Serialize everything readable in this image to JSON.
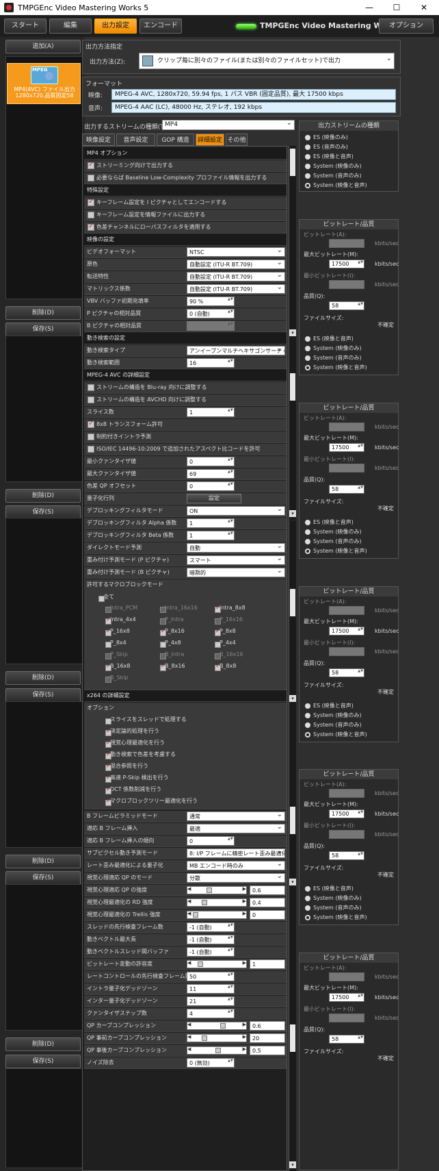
{
  "window": {
    "title": "TMPGEnc Video Mastering Works 5",
    "min": "—",
    "max": "☐",
    "close": "✕"
  },
  "nav": {
    "start": "スタート",
    "edit": "編集",
    "output": "出力設定",
    "encode": "エンコード",
    "brand": "TMPGEnc Video Mastering Works 5",
    "options": "オプション"
  },
  "left": {
    "add": "追加(A)",
    "delete": "削除(D)",
    "save": "保存(S)",
    "clip": {
      "badge": "MPEG",
      "line1": "MP4(AVC) ファイル出力",
      "line2": "1280x720,品質固定58"
    }
  },
  "output_method": {
    "header": "出力方法指定",
    "label": "出力方法(Z):",
    "value": "クリップ毎に別々のファイル(または別々のファイルセット)で出力"
  },
  "format": {
    "header": "フォーマット",
    "video_label": "映像:",
    "video": "MPEG-4 AVC, 1280x720, 59.94 fps, 1 パス VBR (固定品質), 最大 17500 kbps",
    "audio_label": "音声:",
    "audio": "MPEG-4 AAC (LC), 48000 Hz, ステレオ, 192 kbps"
  },
  "stream": {
    "label": "出力するストリームの種類(T):",
    "value": "MP4"
  },
  "tabs": [
    "映像設定",
    "音声設定",
    "GOP 構造",
    "詳細設定",
    "その他"
  ],
  "rows": [
    {
      "k": "h",
      "t": "MP4 オプション"
    },
    {
      "k": "c",
      "t": "ストリーミング向けで出力する",
      "on": true
    },
    {
      "k": "c",
      "t": "必要ならば Baseline Low-Complexity プロファイル情報を出力する",
      "on": false
    },
    {
      "k": "h",
      "t": "特殊設定"
    },
    {
      "k": "c",
      "t": "キーフレーム設定を I ピクチャとしてエンコードする",
      "on": true
    },
    {
      "k": "c",
      "t": "キーフレーム設定を情報ファイルに出力する",
      "on": false
    },
    {
      "k": "c",
      "t": "色差チャンネルにローパスフィルタを適用する",
      "on": true
    },
    {
      "k": "h",
      "t": "映像の設定"
    },
    {
      "k": "d",
      "t": "ビデオフォーマット",
      "v": "NTSC"
    },
    {
      "k": "d",
      "t": "原色",
      "v": "自動設定 (ITU-R BT.709)"
    },
    {
      "k": "d",
      "t": "転送特性",
      "v": "自動設定 (ITU-R BT.709)"
    },
    {
      "k": "d",
      "t": "マトリックス係数",
      "v": "自動設定 (ITU-R BT.709)"
    },
    {
      "k": "s",
      "t": "VBV バッファ初期充填率",
      "v": "90 %"
    },
    {
      "k": "s",
      "t": "P ピクチャの相対品質",
      "v": "0 (自動)"
    },
    {
      "k": "x",
      "t": "B ピクチャの相対品質",
      "v": ""
    },
    {
      "k": "h",
      "t": "動き検索の設定"
    },
    {
      "k": "d",
      "t": "動き検索タイプ",
      "v": "アンイーブンマルチヘキサゴンサーチ (UM"
    },
    {
      "k": "s",
      "t": "動き検索範囲",
      "v": "16"
    },
    {
      "k": "h",
      "t": "MPEG-4 AVC の詳細設定"
    },
    {
      "k": "c",
      "t": "ストリームの構造を Blu-ray 向けに調整する",
      "on": false
    },
    {
      "k": "c",
      "t": "ストリームの構造を AVCHD 向けに調整する",
      "on": false
    },
    {
      "k": "s",
      "t": "スライス数",
      "v": "1"
    },
    {
      "k": "c",
      "t": "8x8 トランスフォーム許可",
      "on": true
    },
    {
      "k": "c",
      "t": "制約付きイントラ予測",
      "on": false
    },
    {
      "k": "c",
      "t": "ISO/IEC 14496-10:2009 で追加されたアスペクト比コードを許可",
      "on": false
    },
    {
      "k": "s",
      "t": "最小クァンタイザ値",
      "v": "0"
    },
    {
      "k": "s",
      "t": "最大クァンタイザ値",
      "v": "69"
    },
    {
      "k": "s",
      "t": "色差 QP オフセット",
      "v": "0"
    },
    {
      "k": "b",
      "t": "量子化行列",
      "v": "設定"
    },
    {
      "k": "d",
      "t": "デブロッキングフィルタモード",
      "v": "ON"
    },
    {
      "k": "s",
      "t": "デブロッキングフィルタ Alpha 係数",
      "v": "1"
    },
    {
      "k": "s",
      "t": "デブロッキングフィルタ Beta 係数",
      "v": "1"
    },
    {
      "k": "d",
      "t": "ダイレクトモード予測",
      "v": "自動"
    },
    {
      "k": "d",
      "t": "重み付け予測モード (P ピクチャ)",
      "v": "スマート"
    },
    {
      "k": "d",
      "t": "重み付け予測モード (B ピクチャ)",
      "v": "暗黙的"
    }
  ],
  "mb": {
    "header": "許可するマクロブロックモード",
    "all": "全て",
    "items": [
      {
        "t": "Intra_PCM",
        "on": false,
        "dis": true
      },
      {
        "t": "Intra_16x16",
        "on": false,
        "dis": true
      },
      {
        "t": "Intra_8x8",
        "on": true,
        "dis": false
      },
      {
        "t": "Intra_4x4",
        "on": true,
        "dis": false
      },
      {
        "t": "P_Intra",
        "on": false,
        "dis": true
      },
      {
        "t": "P_16x16",
        "on": false,
        "dis": true
      },
      {
        "t": "P_16x8",
        "on": true,
        "dis": false
      },
      {
        "t": "P_8x16",
        "on": true,
        "dis": false
      },
      {
        "t": "P_8x8",
        "on": true,
        "dis": false
      },
      {
        "t": "P_8x4",
        "on": false,
        "dis": false
      },
      {
        "t": "P_4x8",
        "on": false,
        "dis": false
      },
      {
        "t": "P_4x4",
        "on": false,
        "dis": false
      },
      {
        "t": "P_Skip",
        "on": false,
        "dis": true
      },
      {
        "t": "B_Intra",
        "on": false,
        "dis": true
      },
      {
        "t": "B_16x16",
        "on": false,
        "dis": true
      },
      {
        "t": "B_16x8",
        "on": true,
        "dis": false
      },
      {
        "t": "B_8x16",
        "on": true,
        "dis": false
      },
      {
        "t": "B_8x8",
        "on": true,
        "dis": false
      },
      {
        "t": "B_Skip",
        "on": false,
        "dis": true
      }
    ]
  },
  "x264": {
    "header": "x264 の詳細設定",
    "opt": "オプション",
    "opts": [
      {
        "t": "スライスをスレッドで処理する",
        "on": false
      },
      {
        "t": "決定論的処理を行う",
        "on": true
      },
      {
        "t": "視覚心理最適化を行う",
        "on": true
      },
      {
        "t": "動き検索で色差を考慮する",
        "on": true
      },
      {
        "t": "混合参照を行う",
        "on": true
      },
      {
        "t": "高速 P-Skip 検出を行う",
        "on": true
      },
      {
        "t": "DCT 係数削減を行う",
        "on": true
      },
      {
        "t": "マクロブロックツリー最適化を行う",
        "on": true
      }
    ]
  },
  "rows2": [
    {
      "k": "d",
      "t": "B フレームピラミッドモード",
      "v": "通常"
    },
    {
      "k": "d",
      "t": "適応 B フレーム挿入",
      "v": "最適"
    },
    {
      "k": "s",
      "t": "適応 B フレーム挿入の傾向",
      "v": "0"
    },
    {
      "k": "d",
      "t": "サブピクセル動き予測モード",
      "v": "8: I/P フレームに精密レート歪み最適化"
    },
    {
      "k": "d",
      "t": "レート歪み最適化による量子化",
      "v": "MB エンコード時のみ"
    },
    {
      "k": "d",
      "t": "視覚心理適応 QP のモード",
      "v": "分散"
    },
    {
      "k": "l",
      "t": "視覚心理適応 QP の強度",
      "v": "0.6",
      "p": 0.3
    },
    {
      "k": "l",
      "t": "視覚心理最適化の RD 強度",
      "v": "0.4",
      "p": 0.2
    },
    {
      "k": "l",
      "t": "視覚心理最適化の Trellis 強度",
      "v": "0",
      "p": 0.0
    },
    {
      "k": "s",
      "t": "スレッドの先行検査フレーム数",
      "v": "-1 (自動)"
    },
    {
      "k": "s",
      "t": "動きベクトル最大長",
      "v": "-1 (自動)"
    },
    {
      "k": "s",
      "t": "動きベクトルスレッド間バッファ",
      "v": "-1 (自動)"
    },
    {
      "k": "l",
      "t": "ビットレート変動の許容度",
      "v": "1",
      "p": 0.1
    },
    {
      "k": "s",
      "t": "レートコントロールの先行検査フレーム数",
      "v": "50"
    },
    {
      "k": "s",
      "t": "イントラ量子化デッドゾーン",
      "v": "11"
    },
    {
      "k": "s",
      "t": "インター量子化デッドゾーン",
      "v": "21"
    },
    {
      "k": "s",
      "t": "クァンタイザステップ数",
      "v": "4"
    },
    {
      "k": "l",
      "t": "QP カーブコンプレッション",
      "v": "0.6",
      "p": 0.6
    },
    {
      "k": "l",
      "t": "QP 事前カーブコンプレッション",
      "v": "20",
      "p": 0.2
    },
    {
      "k": "l",
      "t": "QP 事後カーブコンプレッション",
      "v": "0.5",
      "p": 0.5
    },
    {
      "k": "s",
      "t": "ノイズ除去",
      "v": "0 (無効)"
    }
  ],
  "stream_panel": {
    "header": "出力ストリームの種類",
    "opts": [
      "ES (映像のみ)",
      "ES (音声のみ)",
      "ES (映像と音声)",
      "System (映像のみ)",
      "System (音声のみ)",
      "System (映像と音声)"
    ],
    "sel": 5,
    "partial": [
      "ES (映像と音声)",
      "System (映像のみ)",
      "System (音声のみ)",
      "System (映像と音声)"
    ]
  },
  "bitrate": {
    "header": "ビットレート/品質",
    "bitrate": "ビットレート(A):",
    "max": "最大ビットレート(M):",
    "max_v": "17500",
    "min": "最小ビットレート(I):",
    "q": "品質(Q):",
    "q_v": "58",
    "unit": "kbits/sec",
    "size": "ファイルサイズ:",
    "size_v": "不確定"
  }
}
